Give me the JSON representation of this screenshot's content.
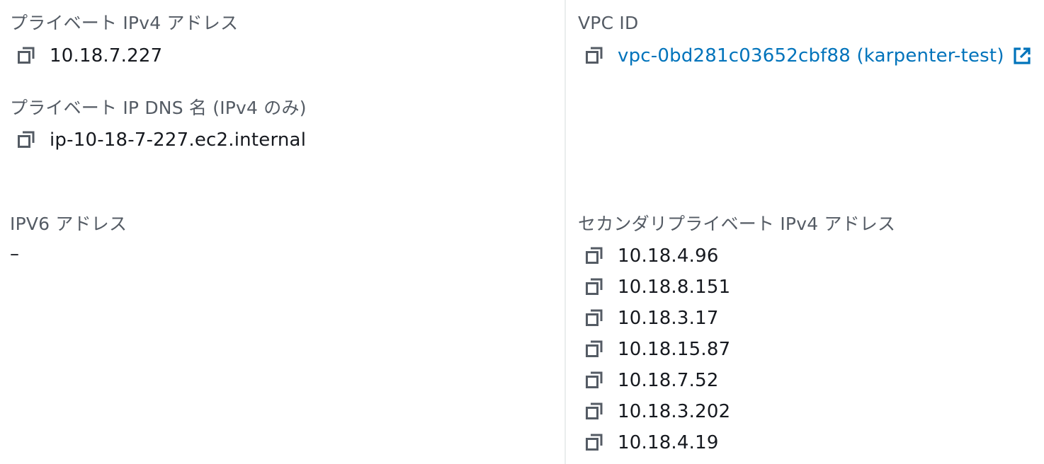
{
  "left": {
    "private_ipv4": {
      "label": "プライベート IPv4 アドレス",
      "value": "10.18.7.227"
    },
    "private_dns": {
      "label": "プライベート IP DNS 名 (IPv4 のみ)",
      "value": "ip-10-18-7-227.ec2.internal"
    },
    "ipv6": {
      "label": "IPV6 アドレス",
      "value": "–"
    }
  },
  "right": {
    "vpc": {
      "label": "VPC ID",
      "link_text": "vpc-0bd281c03652cbf88 (karpenter-test)"
    },
    "secondary_ipv4": {
      "label": "セカンダリプライベート IPv4 アドレス",
      "addresses": [
        "10.18.4.96",
        "10.18.8.151",
        "10.18.3.17",
        "10.18.15.87",
        "10.18.7.52",
        "10.18.3.202",
        "10.18.4.19"
      ]
    }
  },
  "icons": {
    "copy": "copy-icon",
    "external_link": "external-link-icon"
  },
  "colors": {
    "label": "#545b64",
    "value": "#16191f",
    "link": "#0073bb",
    "icon": "#545b64",
    "divider": "#eaeded"
  }
}
